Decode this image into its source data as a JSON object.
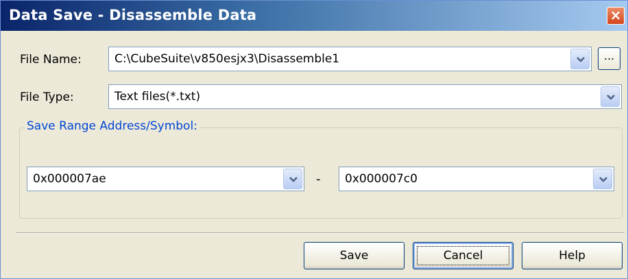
{
  "window": {
    "title": "Data Save - Disassemble Data",
    "close_glyph": "×"
  },
  "file_name": {
    "label": "File Name:",
    "value": "C:\\CubeSuite\\v850esjx3\\Disassemble1",
    "browse_label": "..."
  },
  "file_type": {
    "label": "File Type:",
    "value": "Text files(*.txt)"
  },
  "range": {
    "group_label": "Save Range Address/Symbol:",
    "start_value": "0x000007ae",
    "separator": "-",
    "end_value": "0x000007c0"
  },
  "buttons": {
    "save": "Save",
    "cancel": "Cancel",
    "help": "Help"
  },
  "icons": {
    "dropdown": "chevron-down-icon",
    "close": "close-icon"
  }
}
